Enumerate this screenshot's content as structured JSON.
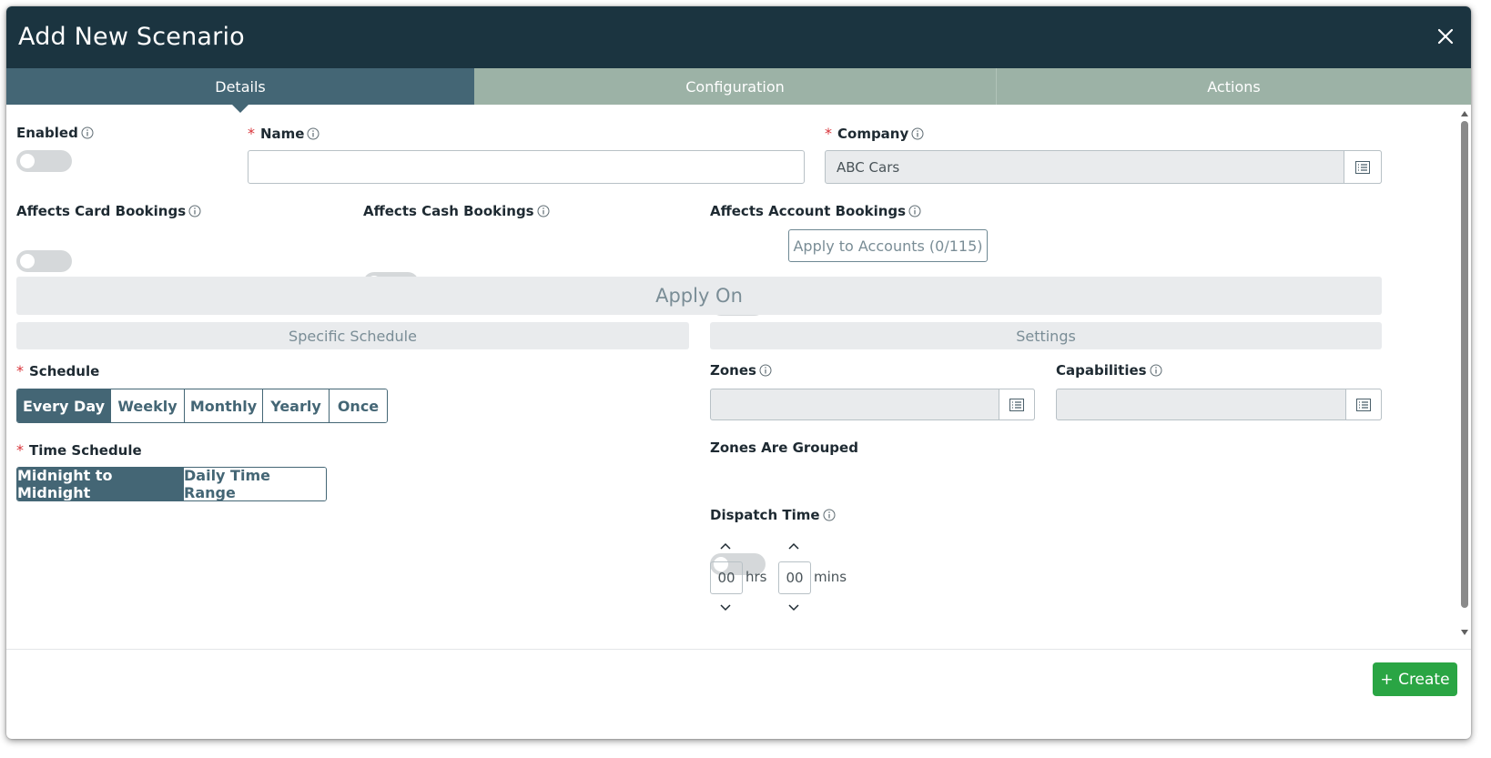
{
  "dialog": {
    "title": "Add New Scenario"
  },
  "tabs": [
    {
      "label": "Details",
      "active": true
    },
    {
      "label": "Configuration",
      "active": false
    },
    {
      "label": "Actions",
      "active": false
    }
  ],
  "fields": {
    "enabled": {
      "label": "Enabled",
      "on": false
    },
    "name": {
      "label": "Name",
      "value": "",
      "required": true
    },
    "company": {
      "label": "Company",
      "value": "ABC Cars",
      "required": true
    },
    "affects_card": {
      "label": "Affects Card Bookings",
      "on": false
    },
    "affects_cash": {
      "label": "Affects Cash Bookings",
      "on": false
    },
    "affects_account": {
      "label": "Affects Account Bookings",
      "on": false
    },
    "apply_accounts_label": "Apply to Accounts (0/115)"
  },
  "apply_on": {
    "title": "Apply On",
    "left_section": "Specific Schedule",
    "right_section": "Settings"
  },
  "schedule": {
    "label": "Schedule",
    "options": [
      "Every Day",
      "Weekly",
      "Monthly",
      "Yearly",
      "Once"
    ],
    "selected": "Every Day"
  },
  "time_schedule": {
    "label": "Time Schedule",
    "options": [
      "Midnight to Midnight",
      "Daily Time Range"
    ],
    "selected": "Midnight to Midnight"
  },
  "settings": {
    "zones_label": "Zones",
    "zones_value": "",
    "capabilities_label": "Capabilities",
    "capabilities_value": "",
    "zones_grouped_label": "Zones Are Grouped",
    "zones_grouped_on": false,
    "dispatch_time_label": "Dispatch Time",
    "hours": "00",
    "hours_unit": "hrs",
    "minutes": "00",
    "minutes_unit": "mins"
  },
  "footer": {
    "create_label": "+ Create"
  },
  "colors": {
    "header_bg": "#1b3440",
    "tab_active": "#446675",
    "tab_inactive": "#9cb2a6",
    "required": "#d9343a",
    "create_button": "#2aa544"
  },
  "icons": {
    "close": "close-icon",
    "info": "info-icon",
    "list_picker": "list-icon",
    "chevron_up": "chevron-up-icon",
    "chevron_down": "chevron-down-icon"
  }
}
